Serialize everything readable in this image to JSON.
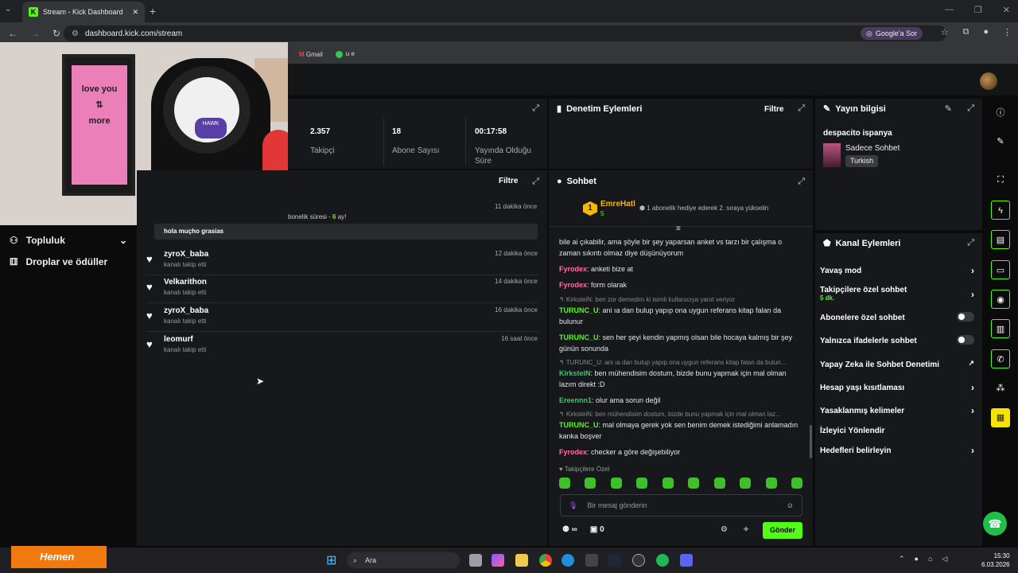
{
  "browser": {
    "tab_title": "Stream - Kick Dashboard",
    "url": "dashboard.kick.com/stream",
    "google_sor": "Google'a Sor",
    "bookmarks": [
      "Gmail",
      "u e"
    ]
  },
  "sidebar": {
    "items": [
      {
        "label": "Topluluk"
      },
      {
        "label": "Droplar ve ödüller"
      }
    ]
  },
  "stats": {
    "followers_value": "2.357",
    "followers_label": "Takipçi",
    "subs_value": "18",
    "subs_label": "Abone Sayısı",
    "uptime_value": "00:17:58",
    "uptime_label": "Yayında Olduğu Süre"
  },
  "activity": {
    "filter_label": "Filtre",
    "first_time": "11 dakika önce",
    "first_text_prefix": "bonelik süresi - ",
    "first_text_value": "6",
    "first_text_suffix": " ay!",
    "chat_line": "hola muçho grasias",
    "items": [
      {
        "name": "zyroX_baba",
        "sub": "kanalı takip etti",
        "time": "12 dakika önce"
      },
      {
        "name": "Velkarithon",
        "sub": "kanalı takip etti",
        "time": "14 dakika önce"
      },
      {
        "name": "zyroX_baba",
        "sub": "kanalı takip etti",
        "time": "16 dakika önce"
      },
      {
        "name": "leomurf",
        "sub": "kanalı takip etti",
        "time": "16 saat önce"
      }
    ]
  },
  "moderation": {
    "title": "Denetim Eylemleri",
    "filter_label": "Filtre"
  },
  "chat": {
    "title": "Sohbet",
    "pinned_user": "EmreHatl",
    "pinned_badge": "1",
    "pinned_sub": "5",
    "pinned_text": "1 abonelik hediye ederek 2. sıraya yükselin",
    "messages": [
      {
        "user": "",
        "text": "bile ai çıkabilir, ama şöyle bir şey yaparsan anket vs tarzı bir çalışma o zaman sıkıntı olmaz diye düşünüyorum",
        "color": "#e6e6e6"
      },
      {
        "user": "Fyrodex",
        "text": ": anketi bize at",
        "color": "#ff6fa8"
      },
      {
        "user": "Fyrodex",
        "text": ": form olarak",
        "color": "#ff6fa8"
      },
      {
        "reply": "↰ KirksteiN: ben zor demedim ki isimli kullanıcıya yanıt veriyor"
      },
      {
        "user": "TURUNC_U",
        "text": ": ani ıa dan bulup yapıp ona uygun referans kitap falan da bulunur",
        "color": "#53fc18"
      },
      {
        "user": "TURUNC_U",
        "text": ": sen her şeyi kendin yapmış olsan bile hocaya kalmış bir şey günün sonunda",
        "color": "#53fc18"
      },
      {
        "reply": "↰ TURUNC_U: ani ıa dan bulup yapıp ona uygun referans kitap falan da bulun..."
      },
      {
        "user": "KirksteiN",
        "text": ": ben mühendisim dostum, bizde bunu yapmak için mal olman lazım direkt :D",
        "color": "#2ecc71"
      },
      {
        "user": "Ereennn1",
        "text": ": olur ama sorun değil",
        "color": "#2ecc71"
      },
      {
        "reply": "↰ KirksteiN: ben mühendisim dostum, bizde bunu yapmak için mal olman laz..."
      },
      {
        "user": "TURUNC_U",
        "text": ": mal olmaya gerek yok sen benim demek istediğimi anlamadın kanka boşver",
        "color": "#53fc18"
      },
      {
        "user": "Fyrodex",
        "text": ": checker a göre değişebiliyor",
        "color": "#ff6fa8"
      }
    ],
    "followers_only": "Takipçilere Özel",
    "input_placeholder": "Bir mesaj gönderin",
    "points": "∞",
    "store_count": "0",
    "send_label": "Gönder"
  },
  "stream_info": {
    "title": "Yayın bilgisi",
    "stream_title": "despacito ispanya",
    "category": "Sadece Sohbet",
    "language": "Turkish"
  },
  "channel_actions": {
    "title": "Kanal Eylemleri",
    "rows": [
      {
        "label": "Yavaş mod"
      },
      {
        "label": "Takipçilere özel sohbet",
        "sub": "5 dk."
      },
      {
        "label": "Abonelere özel sohbet"
      },
      {
        "label": "Yalnızca ifadelerle sohbet"
      },
      {
        "label": "Yapay Zeka ile Sohbet Denetimi"
      },
      {
        "label": "Hesap yaşı kısıtlaması"
      },
      {
        "label": "Yasaklanmış kelimeler"
      },
      {
        "label": "İzleyici Yönlendir"
      },
      {
        "label": "Hedefleri belirleyin"
      }
    ]
  },
  "taskbar": {
    "promo": "Hemen",
    "search": "Ara",
    "time": "15:30",
    "date": "6.03.2026"
  },
  "colors": {
    "accent": "#53fc18",
    "panel": "#17181b",
    "background": "#0b0b0c"
  }
}
